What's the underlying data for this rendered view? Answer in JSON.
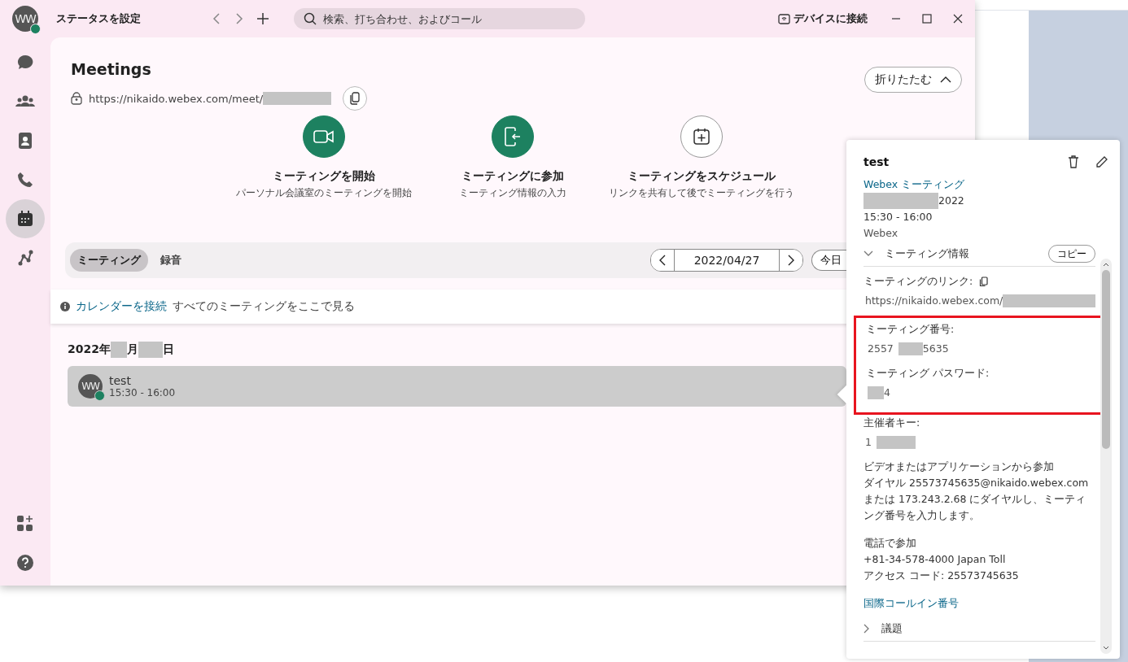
{
  "window": {
    "status_label": "ステータスを設定",
    "search": {
      "placeholder": "検索、打ち合わせ、およびコール"
    },
    "device_button": "デバイスに接続"
  },
  "user": {
    "initials": "WW",
    "online": true
  },
  "sidebar": {
    "items": [
      {
        "kind": "chat",
        "selected": false
      },
      {
        "kind": "teams",
        "selected": false
      },
      {
        "kind": "contacts",
        "selected": false
      },
      {
        "kind": "calls",
        "selected": false
      },
      {
        "kind": "calendar",
        "selected": true
      },
      {
        "kind": "connect",
        "selected": false
      }
    ],
    "bottom_items": [
      {
        "kind": "apps",
        "selected": false
      },
      {
        "kind": "help",
        "selected": false
      }
    ]
  },
  "meetings": {
    "title": "Meetings",
    "url": [
      {
        "text": "https://nikaido.webex.com/meet/"
      },
      {
        "kind": "redacted"
      }
    ],
    "collapse_button": "折りたたむ",
    "actions": [
      {
        "kind": "start",
        "filled": true,
        "title": "ミーティングを開始",
        "subtitle": "パーソナル会議室のミーティングを開始"
      },
      {
        "kind": "join",
        "filled": true,
        "title": "ミーティングに参加",
        "subtitle": "ミーティング情報の入力"
      },
      {
        "kind": "schedule",
        "filled": false,
        "title": "ミーティングをスケジュール",
        "subtitle": "リンクを共有して後でミーティングを行う"
      }
    ],
    "tabs": [
      {
        "label": "ミーティング",
        "selected": true
      },
      {
        "label": "録音",
        "selected": false
      }
    ],
    "date": "2022/04/27",
    "today_button": "今日",
    "notice": {
      "link": "カレンダーを接続",
      "text": "すべてのミーティングをここで見る"
    },
    "day_heading": [
      {
        "text": "2022年"
      },
      {
        "kind": "redacted"
      },
      {
        "text": "月"
      },
      {
        "kind": "redacted"
      },
      {
        "text": "日"
      }
    ],
    "list": [
      {
        "initials": "WW",
        "online": true,
        "title": "test",
        "time": "15:30 - 16:00",
        "selected": true
      }
    ]
  },
  "details": {
    "title": "test",
    "type_link": "Webex ミーティング",
    "date": [
      {
        "kind": "redacted"
      },
      {
        "text": "2022"
      }
    ],
    "time": "15:30 - 16:00",
    "location": "Webex",
    "info_section": {
      "title": "ミーティング情報",
      "expanded": true,
      "copy_button": "コピー"
    },
    "link_label": "ミーティングのリンク:",
    "link": [
      {
        "text": "https://nikaido.webex.com/"
      },
      {
        "kind": "redacted"
      }
    ],
    "highlight": {
      "on": true,
      "fields": [
        {
          "label": "ミーティング番号:",
          "value": [
            {
              "text": "2557"
            },
            {
              "kind": "redacted"
            },
            {
              "text": "5635"
            }
          ]
        },
        {
          "label": "ミーティング パスワード:",
          "value": [
            {
              "kind": "redacted"
            },
            {
              "text": "4"
            }
          ]
        }
      ]
    },
    "host_key": {
      "label": "主催者キー:",
      "value": [
        {
          "text": "1"
        },
        {
          "kind": "redacted"
        }
      ]
    },
    "video_join": {
      "heading": "ビデオまたはアプリケーションから参加",
      "lines": [
        "ダイヤル 25573745635@nikaido.webex.com",
        "または 173.243.2.68 にダイヤルし、ミーティング番号を入力します。"
      ]
    },
    "phone_join": {
      "heading": "電話で参加",
      "lines": [
        "+81-34-578-4000 Japan Toll",
        "アクセス コード: 25573745635"
      ]
    },
    "callin_link": "国際コールイン番号",
    "agenda": {
      "title": "議題",
      "expanded": false
    }
  }
}
